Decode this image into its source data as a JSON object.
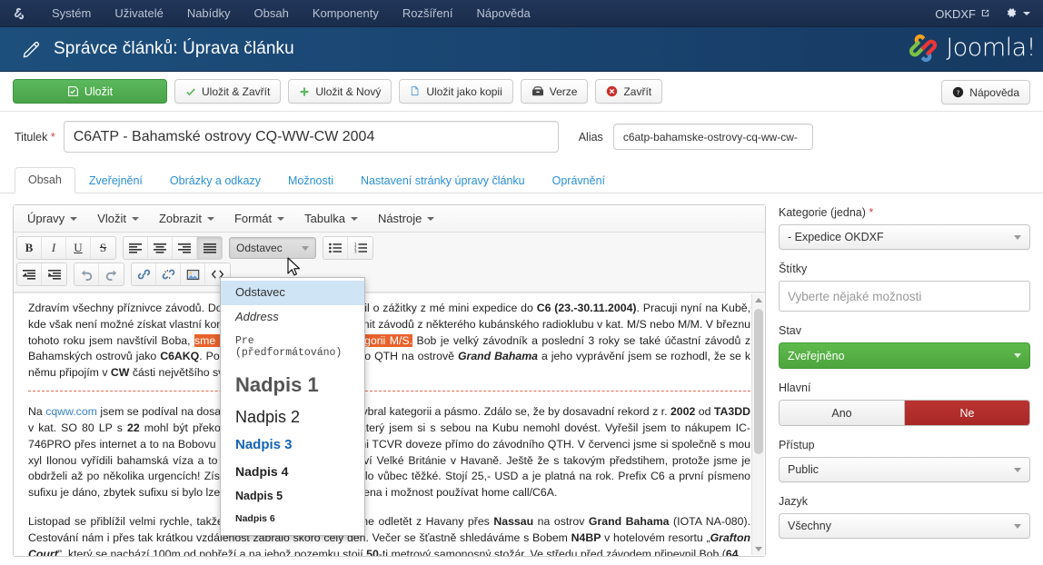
{
  "topbar": {
    "logo_icon": "joomla-logo-icon",
    "menu": [
      {
        "label": "Systém",
        "name": "system"
      },
      {
        "label": "Uživatelé",
        "name": "users"
      },
      {
        "label": "Nabídky",
        "name": "menus"
      },
      {
        "label": "Obsah",
        "name": "content"
      },
      {
        "label": "Komponenty",
        "name": "components"
      },
      {
        "label": "Rozšíření",
        "name": "extensions"
      },
      {
        "label": "Nápověda",
        "name": "help"
      }
    ],
    "site_name": "OKDXF",
    "external_icon": "external-link-icon",
    "gear_icon": "gear-icon"
  },
  "header": {
    "icon": "pencil-icon",
    "title": "Správce článků: Úprava článku",
    "brand": "Joomla!",
    "brand_reg": "®"
  },
  "toolbar": {
    "buttons": [
      {
        "label": "Uložit",
        "icon": "save-check-icon",
        "name": "save"
      },
      {
        "label": "Uložit & Zavřít",
        "icon": "check-icon",
        "name": "save-close"
      },
      {
        "label": "Uložit & Nový",
        "icon": "plus-icon",
        "name": "save-new"
      },
      {
        "label": "Uložit jako kopii",
        "icon": "copy-icon",
        "name": "save-copy"
      },
      {
        "label": "Verze",
        "icon": "archive-icon",
        "name": "versions"
      },
      {
        "label": "Zavřít",
        "icon": "close-circle-icon",
        "name": "close"
      }
    ],
    "help": {
      "label": "Nápověda",
      "icon": "question-circle-icon"
    }
  },
  "form": {
    "title_label": "Titulek",
    "title_required": "*",
    "title_value": "C6ATP - Bahamské ostrovy CQ-WW-CW 2004",
    "title_placeholder": "",
    "alias_label": "Alias",
    "alias_value": "c6atp-bahamske-ostrovy-cq-ww-cw-",
    "alias_placeholder": ""
  },
  "tabs": [
    {
      "label": "Obsah",
      "active": true
    },
    {
      "label": "Zveřejnění",
      "active": false
    },
    {
      "label": "Obrázky a odkazy",
      "active": false
    },
    {
      "label": "Možnosti",
      "active": false
    },
    {
      "label": "Nastavení stránky úpravy článku",
      "active": false
    },
    {
      "label": "Oprávnění",
      "active": false
    }
  ],
  "editor": {
    "menubar": [
      {
        "label": "Úpravy",
        "name": "edit"
      },
      {
        "label": "Vložit",
        "name": "insert"
      },
      {
        "label": "Zobrazit",
        "name": "view"
      },
      {
        "label": "Formát",
        "name": "format"
      },
      {
        "label": "Tabulka",
        "name": "table"
      },
      {
        "label": "Nástroje",
        "name": "tools"
      }
    ],
    "format_select_value": "Odstavec",
    "format_menu": [
      {
        "label": "Odstavec",
        "cls": "f-para",
        "selected": true
      },
      {
        "label": "Address",
        "cls": "f-addr",
        "selected": false
      },
      {
        "label": "Pre (předformátováno)",
        "cls": "f-pre",
        "selected": false
      },
      {
        "label": "Nadpis 1",
        "cls": "f-h1",
        "selected": false
      },
      {
        "label": "Nadpis 2",
        "cls": "f-h2",
        "selected": false
      },
      {
        "label": "Nadpis 3",
        "cls": "f-h3",
        "selected": false
      },
      {
        "label": "Nadpis 4",
        "cls": "f-h4",
        "selected": false
      },
      {
        "label": "Nadpis 5",
        "cls": "f-h5",
        "selected": false
      },
      {
        "label": "Nadpis 6",
        "cls": "f-h6",
        "selected": false
      }
    ],
    "content": {
      "p1_a": "Zdravím všechny příznivce závodů. Dovolte, abych se s vámi podělil o zážitky z mé mini expedice do ",
      "p1_b": "C6 (23.-30.11.2004)",
      "p1_c": ". Pracuji nyní na Kubě, kde však není možné získat vlastní koncesi a tak je možné se účastnit závodů z některého kubánského radioklubu v kat. M/S nebo M/M. V březnu tohoto roku jsem navštívil Boba, ",
      "p1_hl": "sme odjeli SSB část ARRL v kategorii M/S.",
      "p1_d": " Bob je velký závodník a poslední 3 roky se také účastní závodů z Bahamských ostrovů jako ",
      "p1_e": "C6AKQ",
      "p1_f": ". Po zhlédnutí fotografií závodního QTH na ostrově ",
      "p1_g": "Grand Bahama",
      "p1_h": " a jeho vyprávění jsem se rozhodl, že se k němu připojím v ",
      "p1_i": "CW",
      "p1_j": " části největšího světového závodu.",
      "p2_a": "Na ",
      "p2_link": "cqww.com",
      "p2_b": " jsem se podíval na dosavadní rekordy a podle toho vybral kategorii a pásmo. Zdálo se, že by dosavadní rekord z r. ",
      "p2_c": "2002",
      "p2_d": " od ",
      "p2_e": "TA3DD",
      "p2_f": " v kat. SO 80 LP s ",
      "p2_g": "22",
      "p2_h": " mohl být překonán. Problém byl s TCVR, který jsem si s sebou na Kubu nemohl dovést. Vyřešil jsem to nákupem IC-746PRO přes internet a to na Bobovu miamskou adresu, s tím že mi TCVR doveze přímo do závodního QTH. V červenci jsme si společně s mou xyl Ilonou vyřídili bahamská víza a to prostřednictvím velvyslanectví Velké Británie v Havaně. Ještě že s takovým předstihem, protože jsme je obdrželi až po několika urgencích! Získat koncesi oproti tomu nebylo vůbec těžké. Stojí 25,- USD a je platná na rok. Prefix C6 a první písmeno sufixu je dáno, zbytek sufixu si bylo lze vybrat. V povolení byla uvedena i možnost používat home call/C6A.",
      "p3_a": "Listopad se přiblížil velmi rychle, takže 23.11. vyrážíme. Museli jsme odletět z Havany přes ",
      "p3_b": "Nassau",
      "p3_c": " na ostrov ",
      "p3_d": "Grand Bahama",
      "p3_e": " (IOTA NA-080). Cestování nám i přes tak krátkou vzdálenost zabralo skoro celý den. Večer se šťastně shledáváme s Bobem ",
      "p3_f": "N4BP",
      "p3_g": " v hotelovém resortu „",
      "p3_h": "Grafton Court",
      "p3_i": "\", který se nachází 100m od pobřeží a na jehož pozemku stojí ",
      "p3_j": "50",
      "p3_k": "-ti metrový samonosný stožár. Ve středu před závodem připevnil Bob (",
      "p3_l": "64"
    }
  },
  "sidebar": {
    "category": {
      "label": "Kategorie (jedna)",
      "required": "*",
      "value": "- Expedice OKDXF"
    },
    "tags": {
      "label": "Štítky",
      "placeholder": "Vyberte nějaké možnosti",
      "value": ""
    },
    "status": {
      "label": "Stav",
      "value": "Zveřejněno"
    },
    "featured": {
      "label": "Hlavní",
      "yes": "Ano",
      "no": "Ne",
      "selected": "Ne"
    },
    "access": {
      "label": "Přístup",
      "value": "Public"
    },
    "language": {
      "label": "Jazyk",
      "value": "Všechny"
    }
  },
  "colors": {
    "accent_blue": "#1c3050",
    "header_blue": "#1a4572",
    "save_green": "#4da53d",
    "danger_red": "#a82826",
    "highlight_orange": "#e8622c",
    "link_blue": "#3a82c4"
  }
}
